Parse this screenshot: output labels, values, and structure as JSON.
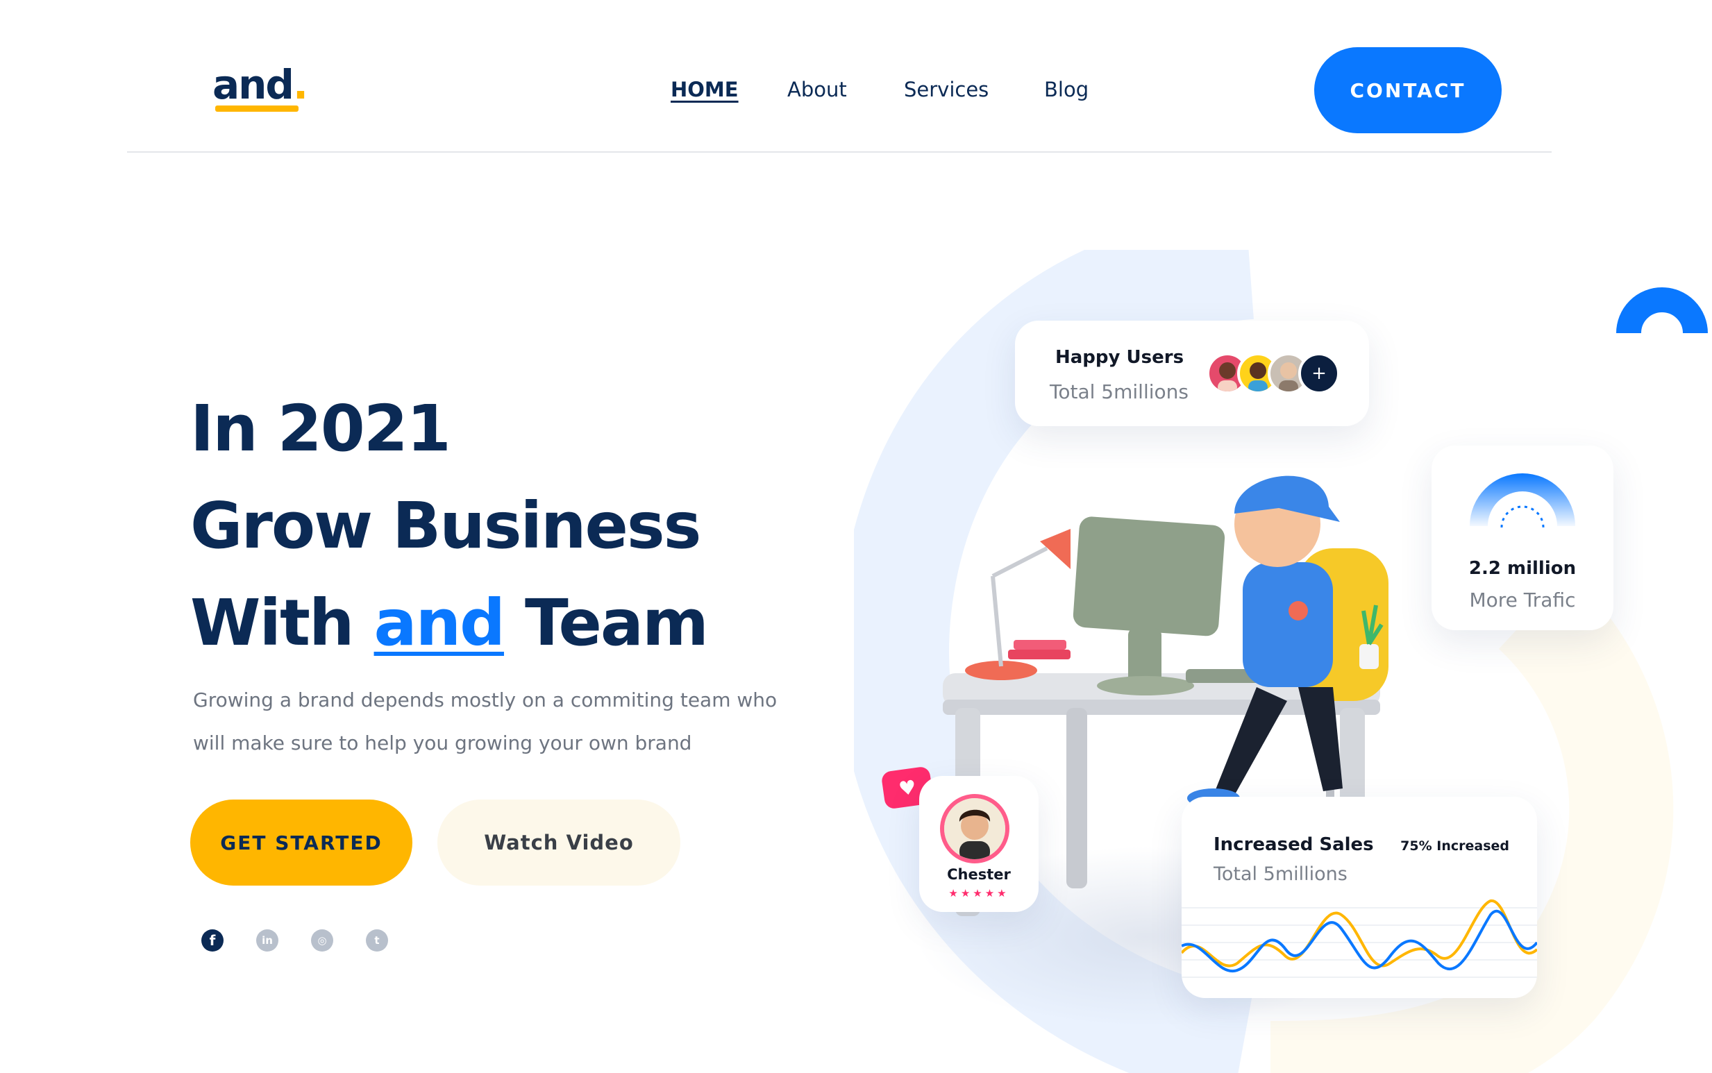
{
  "brand": {
    "name": "and",
    "dot": "."
  },
  "nav": {
    "items": [
      {
        "label": "HOME",
        "active": true
      },
      {
        "label": "About",
        "active": false
      },
      {
        "label": "Services",
        "active": false
      },
      {
        "label": "Blog",
        "active": false
      }
    ],
    "contact_label": "CONTACT"
  },
  "hero": {
    "line1": "In 2021",
    "line2": "Grow Business",
    "line3_before": "With ",
    "line3_highlight": "and",
    "line3_after": " Team",
    "description_line1": "Growing a brand depends mostly on a commiting team who",
    "description_line2": "will make sure  to help you growing your own brand",
    "primary_cta": "GET STARTED",
    "secondary_cta": "Watch Video"
  },
  "social": [
    {
      "name": "facebook",
      "icon": "f"
    },
    {
      "name": "linkedin",
      "icon": "in"
    },
    {
      "name": "instagram",
      "icon": "◎"
    },
    {
      "name": "twitter",
      "icon": "t"
    }
  ],
  "cards": {
    "happy_users": {
      "title": "Happy Users",
      "subtitle": "Total 5millions",
      "more_icon": "+"
    },
    "traffic": {
      "title": "2.2 million",
      "subtitle": "More Trafic"
    },
    "reviewer": {
      "name": "Chester",
      "stars": "★★★★★",
      "rating": 5
    },
    "sales": {
      "title": "Increased Sales",
      "subtitle": "Total 5millions",
      "badge": "75% Increased"
    }
  },
  "colors": {
    "navy": "#0b2a55",
    "blue": "#0a78ff",
    "yellow": "#ffb600",
    "cream": "#fdf8ea",
    "pink": "#ff2c6d",
    "muted": "#6d7480"
  }
}
